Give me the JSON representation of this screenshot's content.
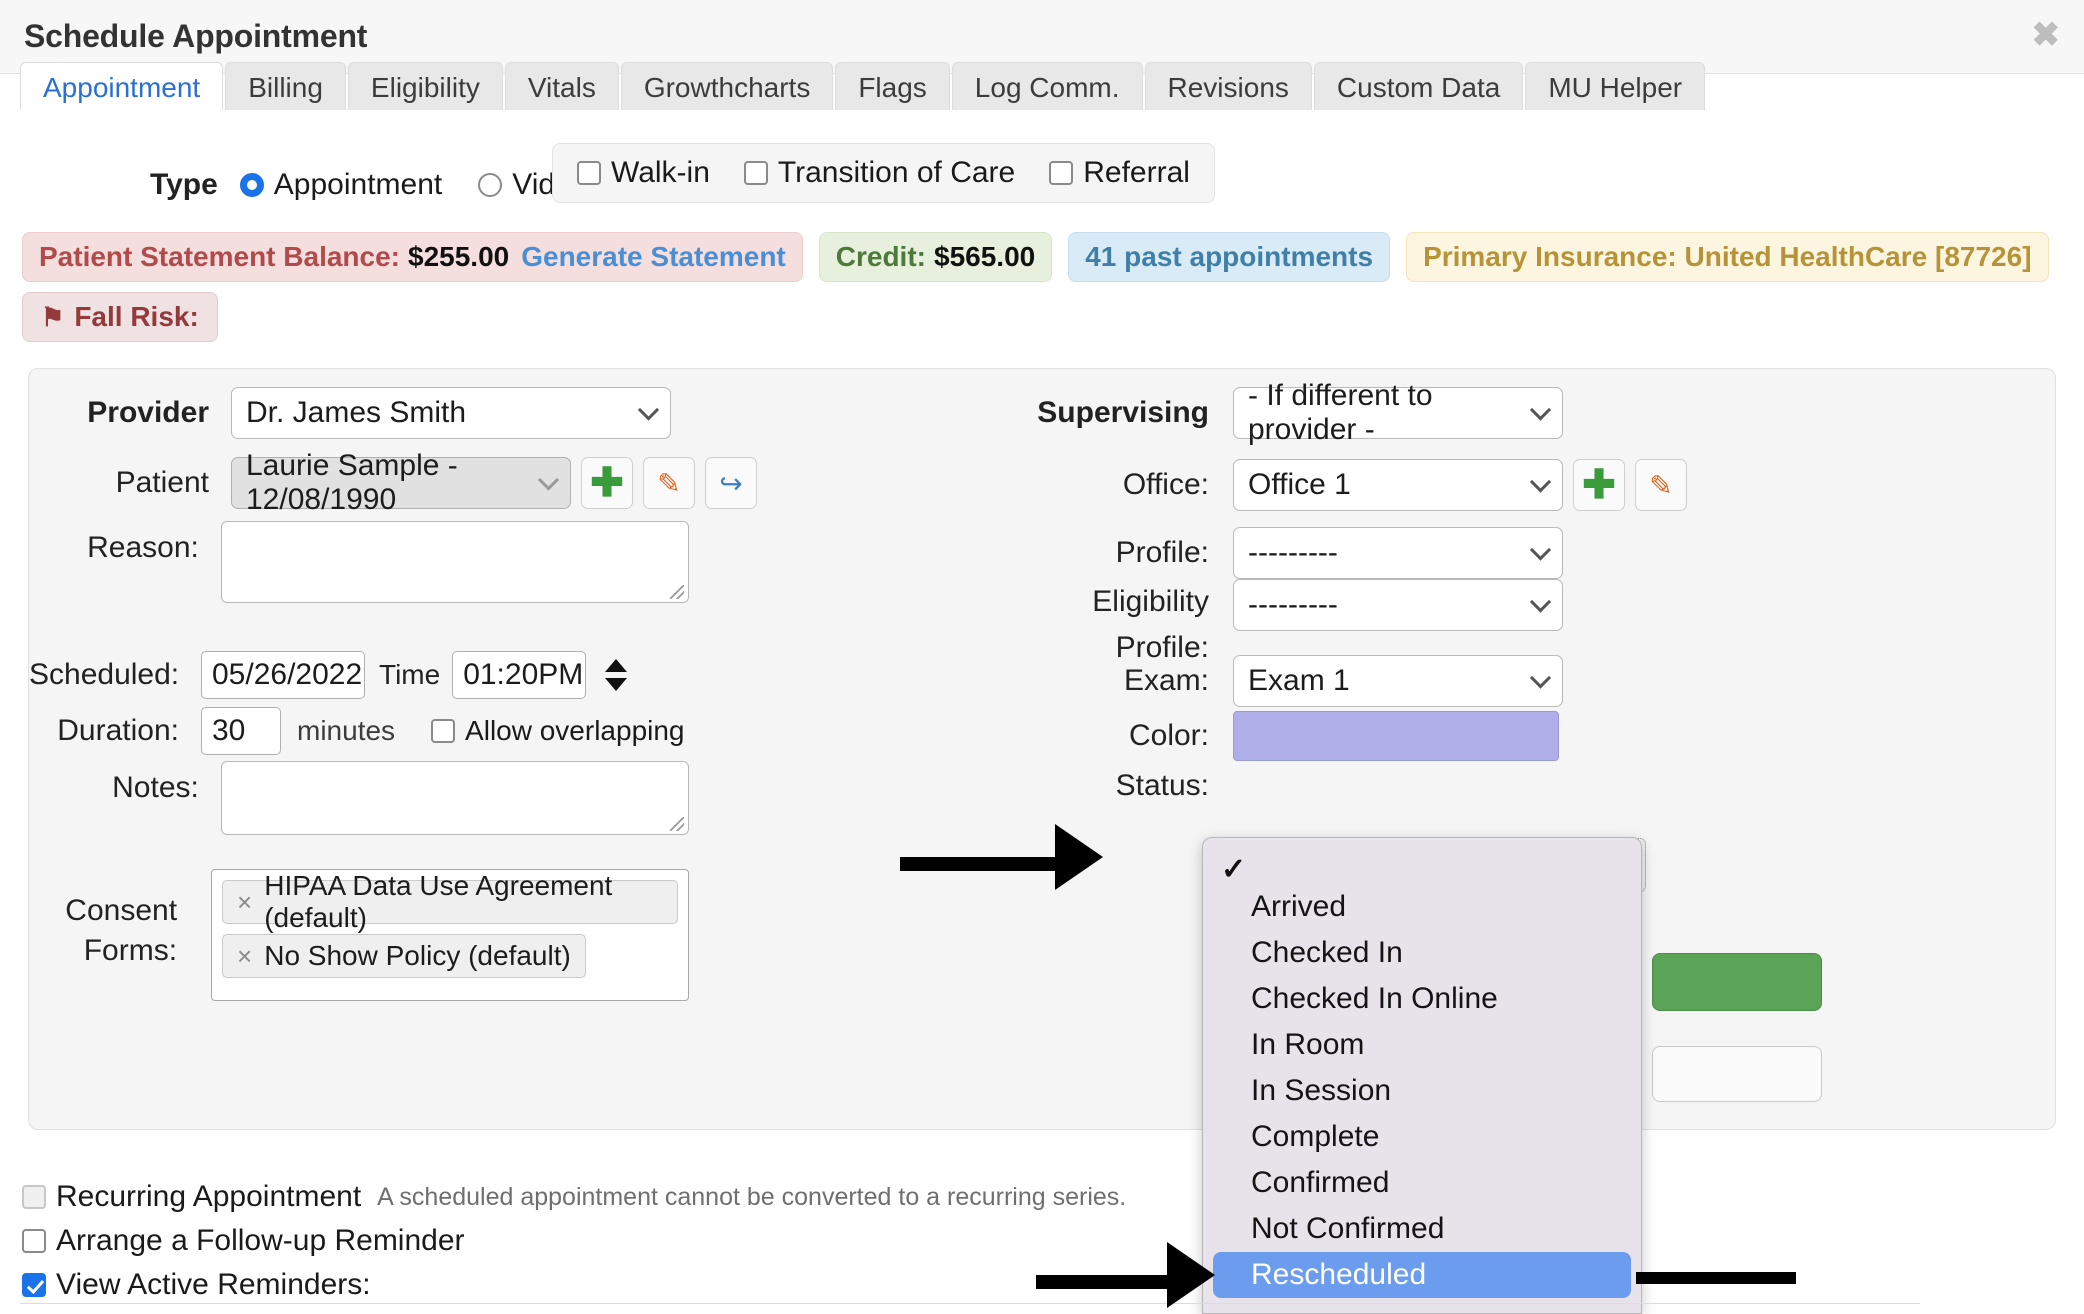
{
  "modal": {
    "title": "Schedule Appointment",
    "close_label": "✖"
  },
  "tabs": [
    {
      "label": "Appointment",
      "active": true
    },
    {
      "label": "Billing",
      "active": false
    },
    {
      "label": "Eligibility",
      "active": false
    },
    {
      "label": "Vitals",
      "active": false
    },
    {
      "label": "Growthcharts",
      "active": false
    },
    {
      "label": "Flags",
      "active": false
    },
    {
      "label": "Log Comm.",
      "active": false
    },
    {
      "label": "Revisions",
      "active": false
    },
    {
      "label": "Custom Data",
      "active": false
    },
    {
      "label": "MU Helper",
      "active": false
    }
  ],
  "type_row": {
    "label": "Type",
    "radios": [
      {
        "label": "Appointment",
        "checked": true
      },
      {
        "label": "Video Visit",
        "checked": false
      }
    ],
    "checkboxes": [
      {
        "label": "Walk-in",
        "checked": false
      },
      {
        "label": "Transition of Care",
        "checked": false
      },
      {
        "label": "Referral",
        "checked": false
      }
    ]
  },
  "badges": {
    "balance_label": "Patient Statement Balance:",
    "balance_amount": "$255.00",
    "generate_statement": "Generate Statement",
    "credit_label": "Credit:",
    "credit_amount": "$565.00",
    "past_appointments": "41 past appointments",
    "primary_insurance": "Primary Insurance: United HealthCare [87726]",
    "fall_risk": "Fall Risk:",
    "flag_icon": "⚑"
  },
  "form_left": {
    "provider_label": "Provider",
    "provider_value": "Dr. James Smith",
    "patient_label": "Patient",
    "patient_value": "Laurie Sample - 12/08/1990",
    "reason_label": "Reason:",
    "reason_value": "",
    "scheduled_label": "Scheduled:",
    "scheduled_date": "05/26/2022",
    "time_label": "Time",
    "time_value": "01:20PM",
    "duration_label": "Duration:",
    "duration_value": "30",
    "minutes_label": "minutes",
    "allow_overlapping_label": "Allow overlapping",
    "allow_overlapping_checked": false,
    "notes_label": "Notes:",
    "notes_value": "",
    "consent_label_line1": "Consent",
    "consent_label_line2": "Forms:",
    "consent_chips": [
      {
        "remove_icon": "×",
        "label": "HIPAA Data Use Agreement (default)"
      },
      {
        "remove_icon": "×",
        "label": "No Show Policy (default)"
      }
    ]
  },
  "form_right": {
    "supervising_label": "Supervising",
    "supervising_value": "- If different to provider -",
    "office_label": "Office:",
    "office_value": "Office 1",
    "profile_label": "Profile:",
    "profile_value": "---------",
    "eligibility_label_line1": "Eligibility",
    "eligibility_label_line2": "Profile:",
    "eligibility_value": "---------",
    "exam_label": "Exam:",
    "exam_value": "Exam 1",
    "color_label": "Color:",
    "color_value": "#aeaee8",
    "status_label": "Status:"
  },
  "status_dropdown": {
    "check_glyph": "✓",
    "options": [
      "",
      "Arrived",
      "Checked In",
      "Checked In Online",
      "In Room",
      "In Session",
      "Complete",
      "Confirmed",
      "Not Confirmed",
      "Rescheduled"
    ],
    "selected_index": 0,
    "highlighted": "Rescheduled",
    "highlight_color": "#6c9cee"
  },
  "bottom": {
    "recurring_label": "Recurring Appointment",
    "recurring_checked": false,
    "recurring_note": "A scheduled appointment cannot be converted to a recurring series.",
    "followup_label": "Arrange a Follow-up Reminder",
    "followup_checked": false,
    "view_reminders_label": "View Active Reminders:",
    "view_reminders_checked": true
  },
  "icons": {
    "add": "✚",
    "edit": "✎",
    "share": "↪"
  }
}
